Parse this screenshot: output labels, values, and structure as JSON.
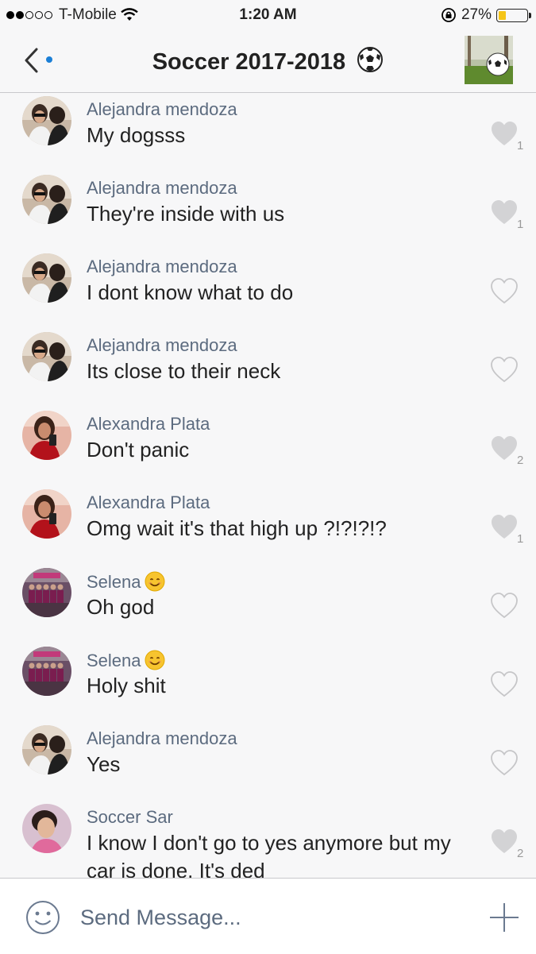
{
  "status_bar": {
    "carrier": "T-Mobile",
    "time": "1:20 AM",
    "battery_percent": "27%",
    "battery_level": 0.27,
    "signal_bars": 2
  },
  "nav": {
    "title": "Soccer 2017-2018",
    "title_emoji": "soccer-ball-icon"
  },
  "messages": [
    {
      "sender": "Alejandra mendoza",
      "text": "My dogsss",
      "likes": "1",
      "liked": true
    },
    {
      "sender": "Alejandra mendoza",
      "text": "They're inside with us",
      "likes": "1",
      "liked": true
    },
    {
      "sender": "Alejandra mendoza",
      "text": "I dont know what to do",
      "likes": "",
      "liked": false
    },
    {
      "sender": "Alejandra mendoza",
      "text": "Its close to their neck",
      "likes": "",
      "liked": false
    },
    {
      "sender": "Alexandra Plata",
      "text": "Don't panic",
      "likes": "2",
      "liked": true
    },
    {
      "sender": "Alexandra Plata",
      "text": "Omg wait it's that high up ?!?!?!?",
      "likes": "1",
      "liked": true
    },
    {
      "sender": "Selena",
      "text": "Oh god",
      "likes": "",
      "liked": false
    },
    {
      "sender": "Selena",
      "text": "Holy shit",
      "likes": "",
      "liked": false
    },
    {
      "sender": "Alejandra mendoza",
      "text": "Yes",
      "likes": "",
      "liked": false
    },
    {
      "sender": "Soccer Sar",
      "text": "I know I don't go to yes anymore but my car is done. It's ded",
      "likes": "2",
      "liked": true
    }
  ],
  "composer": {
    "placeholder": "Send Message..."
  },
  "colors": {
    "sender_name": "#5c6b7f",
    "heart_filled": "#d3d3d5",
    "unread_dot": "#1b7fd6",
    "battery_fill": "#f5c518"
  }
}
